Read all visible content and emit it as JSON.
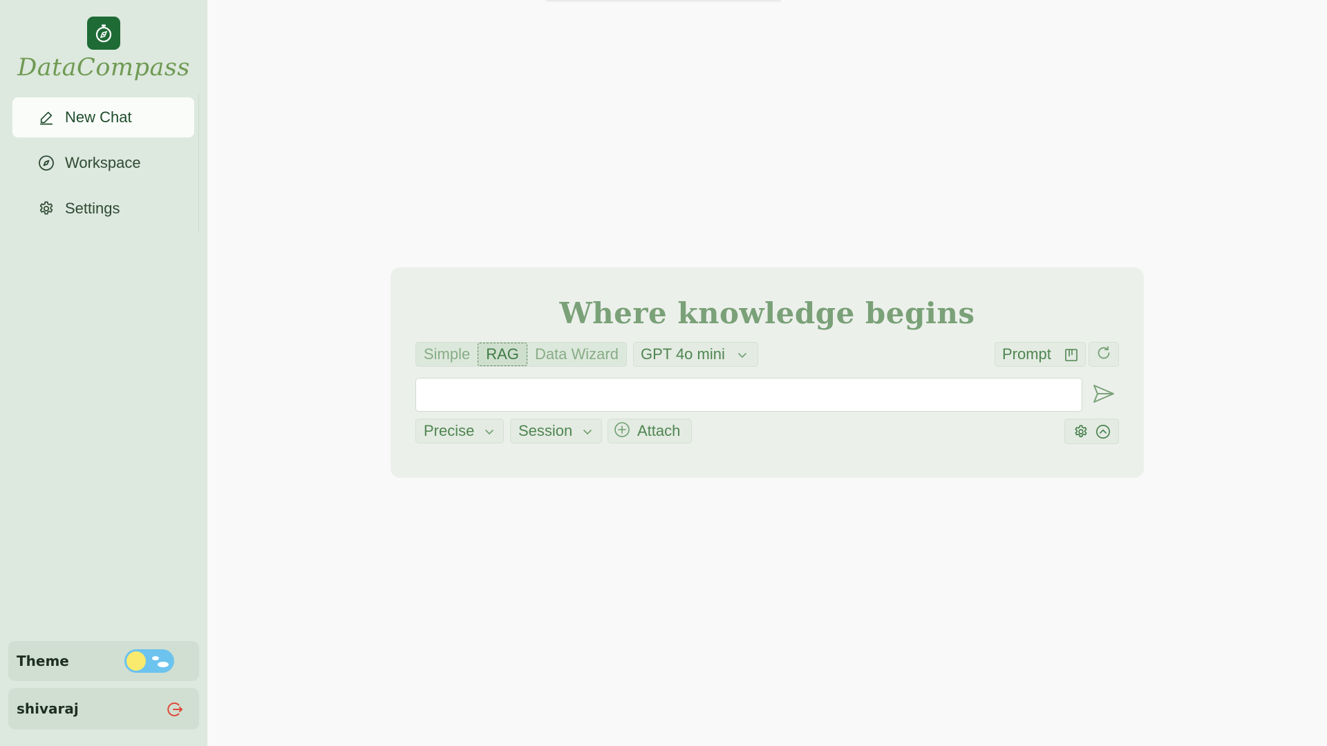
{
  "app": {
    "name": "DataCompass"
  },
  "sidebar": {
    "items": [
      {
        "label": "New Chat",
        "icon": "pencil-icon",
        "active": true
      },
      {
        "label": "Workspace",
        "icon": "compass-icon",
        "active": false
      },
      {
        "label": "Settings",
        "icon": "gear-icon",
        "active": false
      }
    ],
    "theme": {
      "label": "Theme",
      "mode": "light"
    },
    "user": {
      "name": "shivaraj"
    }
  },
  "main": {
    "headline": "Where knowledge begins",
    "modes": [
      {
        "label": "Simple",
        "selected": false
      },
      {
        "label": "RAG",
        "selected": true
      },
      {
        "label": "Data Wizard",
        "selected": false
      }
    ],
    "model": {
      "selected": "GPT 4o mini"
    },
    "prompt_label": "Prompt",
    "input": {
      "value": "",
      "placeholder": ""
    },
    "options": {
      "style": "Precise",
      "scope": "Session",
      "attach_label": "Attach"
    }
  },
  "colors": {
    "sidebar_bg": "#dde8de",
    "accent": "#1f6b36",
    "headline": "#7aa178",
    "logout": "#e0483a"
  }
}
